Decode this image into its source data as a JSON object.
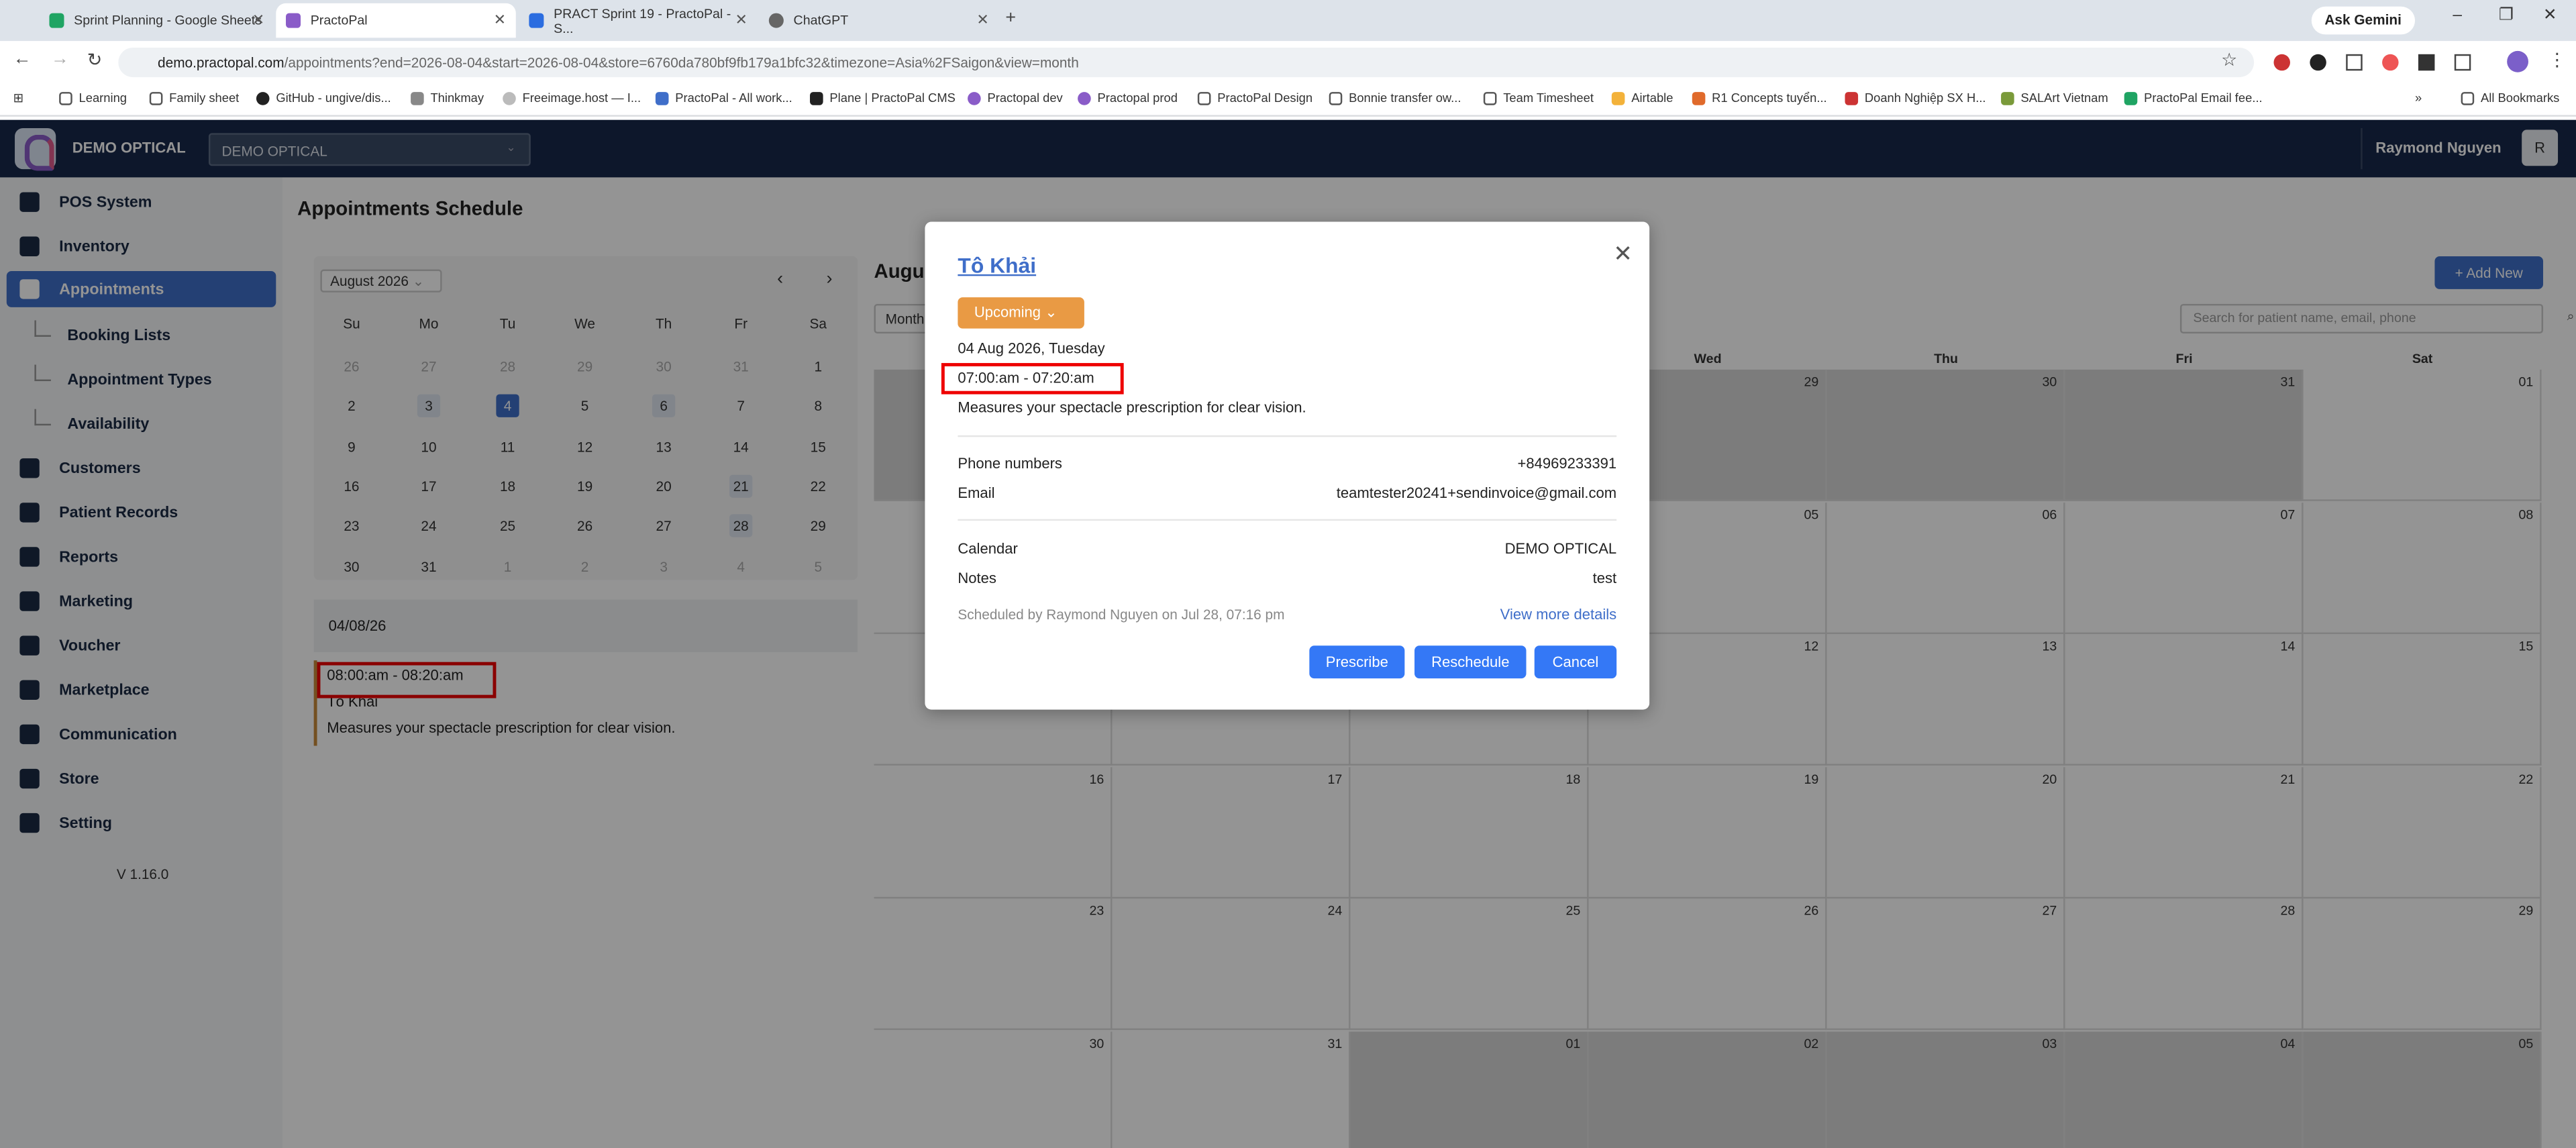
{
  "browser": {
    "tabs": [
      {
        "title": "Sprint Planning - Google Sheets"
      },
      {
        "title": "PractoPal"
      },
      {
        "title": "PRACT Sprint 19 - PractoPal - S..."
      },
      {
        "title": "ChatGPT"
      }
    ],
    "url_host": "demo.practopal.com",
    "url_path": "/appointments?end=2026-08-04&start=2026-08-04&store=6760da780bf9fb179a1bfc32&timezone=Asia%2FSaigon&view=month",
    "ask_gemini": "Ask Gemini",
    "bookmarks": [
      "Learning",
      "Family sheet",
      "GitHub - ungive/dis...",
      "Thinkmay",
      "Freeimage.host — I...",
      "PractoPal - All work...",
      "Plane | PractoPal CMS",
      "Practopal dev",
      "Practopal prod",
      "PractoPal Design",
      "Bonnie transfer ow...",
      "Team Timesheet",
      "Airtable",
      "R1 Concepts tuyển...",
      "Doanh Nghiệp SX H...",
      "SALArt Vietnam",
      "PractoPal Email fee..."
    ],
    "all_bookmarks": "All Bookmarks"
  },
  "header": {
    "brand": "DEMO OPTICAL",
    "store_select": "DEMO OPTICAL",
    "user_name": "Raymond Nguyen",
    "avatar_initial": "R"
  },
  "sidebar": {
    "items": [
      "POS System",
      "Inventory",
      "Appointments",
      "Booking Lists",
      "Appointment Types",
      "Availability",
      "Customers",
      "Patient Records",
      "Reports",
      "Marketing",
      "Voucher",
      "Marketplace",
      "Communication",
      "Store",
      "Setting"
    ],
    "version": "V 1.16.0"
  },
  "page": {
    "title": "Appointments Schedule",
    "mini_month": "August 2026",
    "dow": [
      "Su",
      "Mo",
      "Tu",
      "We",
      "Th",
      "Fr",
      "Sa"
    ],
    "selected_date": "04/08/26",
    "appt_time": "08:00:am - 08:20:am",
    "appt_patient": "Tô Khải",
    "appt_desc": "Measures your spectacle prescription for clear vision.",
    "big_title": "Augu",
    "view_select": "Month",
    "add_new": "+ Add New",
    "search_placeholder": "Search for patient name, email, phone",
    "week_headers": [
      "Wed",
      "Thu",
      "Fri",
      "Sat"
    ]
  },
  "modal": {
    "patient_name": "Tô Khải",
    "status": "Upcoming",
    "date": "04 Aug 2026, Tuesday",
    "time": "07:00:am - 07:20:am",
    "description": "Measures your spectacle prescription for clear vision.",
    "phone_label": "Phone numbers",
    "phone_value": "+84969233391",
    "email_label": "Email",
    "email_value": "teamtester20241+sendinvoice@gmail.com",
    "calendar_label": "Calendar",
    "calendar_value": "DEMO OPTICAL",
    "notes_label": "Notes",
    "notes_value": "test",
    "scheduled_by": "Scheduled by Raymond Nguyen on Jul 28, 07:16 pm",
    "view_more": "View more details",
    "prescribe": "Prescribe",
    "reschedule": "Reschedule",
    "cancel": "Cancel"
  }
}
